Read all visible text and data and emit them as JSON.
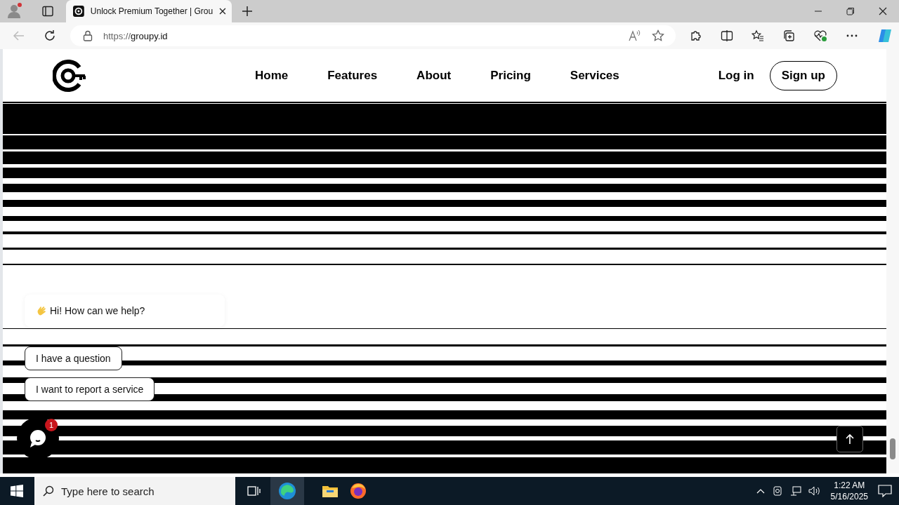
{
  "browser": {
    "tabs": [
      {
        "title": "Unlock Premium Together | Grou",
        "selected": true
      }
    ],
    "url_scheme": "https://",
    "url_host": "groupy.id"
  },
  "nav": {
    "links": [
      "Home",
      "Features",
      "About",
      "Pricing",
      "Services"
    ],
    "login": "Log in",
    "signup": "Sign up"
  },
  "chat": {
    "greeting": "Hi! How can we help?",
    "options": [
      "I have a question",
      "I want to report a service"
    ],
    "badge": "1"
  },
  "taskbar": {
    "search_placeholder": "Type here to search",
    "time": "1:22 AM",
    "date": "5/16/2025"
  }
}
